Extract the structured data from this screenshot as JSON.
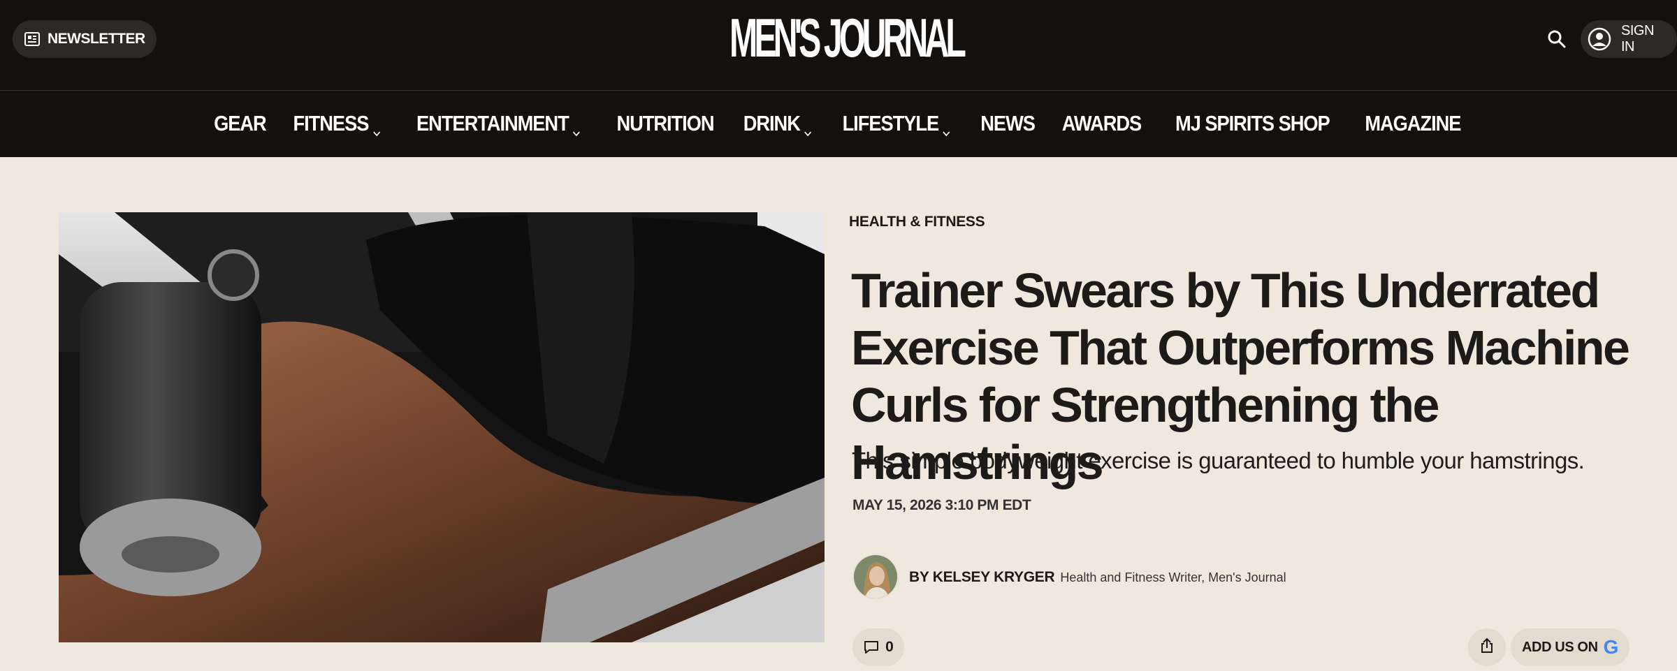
{
  "header": {
    "newsletter_label": "NEWSLETTER",
    "logo_text": "MEN'S JOURNAL",
    "signin_label": "SIGN IN",
    "search_icon": "search-icon",
    "account_icon": "user-circle-icon"
  },
  "nav": {
    "items": [
      {
        "label": "GEAR",
        "dropdown": false
      },
      {
        "label": "FITNESS",
        "dropdown": true
      },
      {
        "label": "ENTERTAINMENT",
        "dropdown": true
      },
      {
        "label": "NUTRITION",
        "dropdown": false
      },
      {
        "label": "DRINK",
        "dropdown": true
      },
      {
        "label": "LIFESTYLE",
        "dropdown": true
      },
      {
        "label": "NEWS",
        "dropdown": false
      },
      {
        "label": "AWARDS",
        "dropdown": false
      },
      {
        "label": "MJ SPIRITS SHOP",
        "dropdown": false
      },
      {
        "label": "MAGAZINE",
        "dropdown": false
      }
    ]
  },
  "article": {
    "category": "HEALTH & FITNESS",
    "headline": "Trainer Swears by This Underrated Exercise That Outperforms Machine Curls for Strengthening the Hamstrings",
    "dek": "This simple bodyweight exercise is guaranteed to humble your hamstrings.",
    "date": "MAY 15, 2026 3:10 PM EDT",
    "author_name": "BY KELSEY KRYGER",
    "author_role": "Health and Fitness Writer, Men's Journal",
    "comment_count": "0",
    "add_us_label": "ADD US ON",
    "google_letter": "G"
  },
  "colors": {
    "header_bg": "#13100d",
    "page_bg": "#efe8df",
    "button_bg": "#e2dbd0",
    "text": "#1c1a17"
  }
}
